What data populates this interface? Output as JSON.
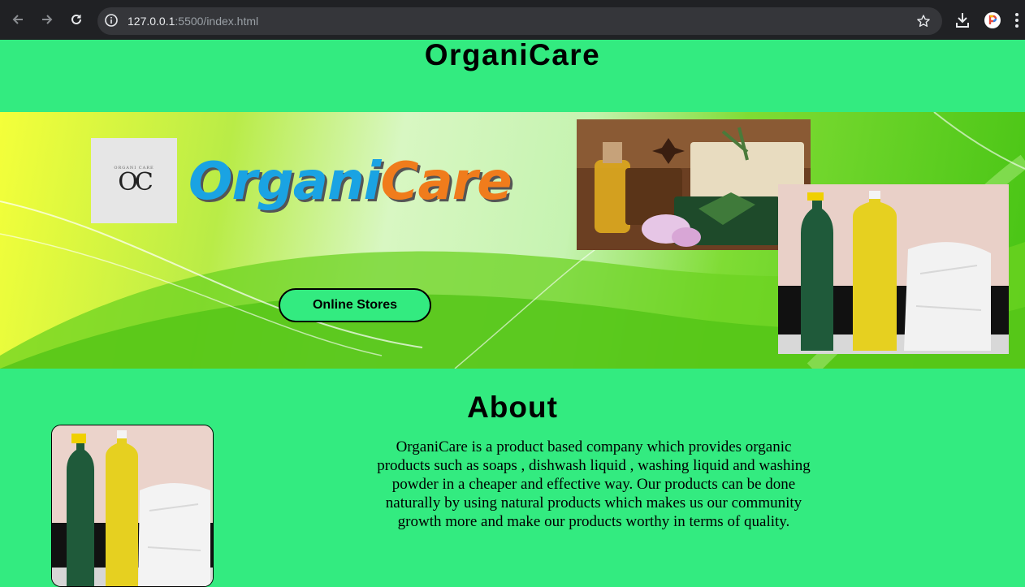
{
  "browser": {
    "url_host": "127.0.0.1",
    "url_path": ":5500/index.html"
  },
  "header": {
    "title": "OrganiCare"
  },
  "banner": {
    "logo_small_text": "ORGANI CARE",
    "logo_mark": "OC",
    "brand_part1": "Organi",
    "brand_part2": "Care",
    "button_label": "Online Stores"
  },
  "about": {
    "title": "About",
    "text": "OrganiCare is a product based company which provides organic products such as soaps , dishwash liquid , washing liquid and washing powder in a cheaper and effective way. Our products can be done naturally by using natural products which makes us our community growth more and make our products worthy in terms of quality."
  },
  "colors": {
    "page_bg": "#33eb80",
    "brand_blue": "#1aa3e3",
    "brand_orange": "#f07c1c",
    "chrome_bg": "#202124"
  }
}
